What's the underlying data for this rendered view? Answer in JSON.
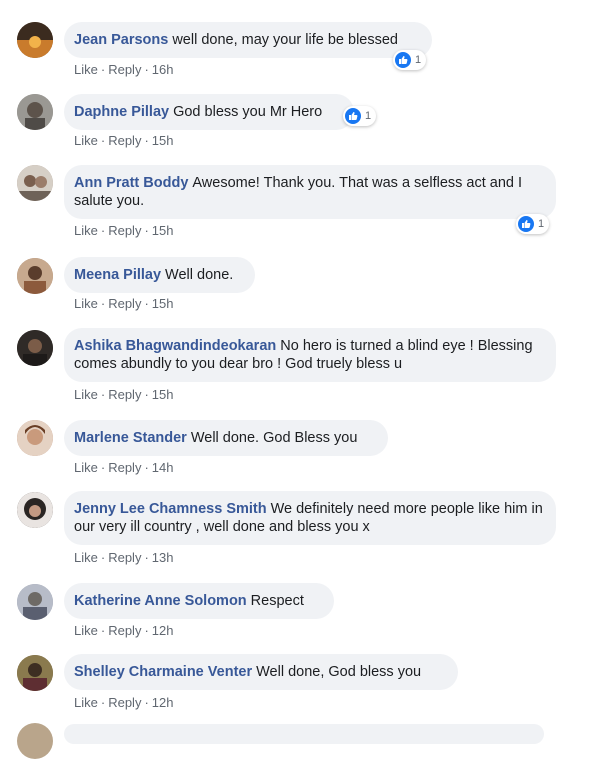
{
  "action_labels": {
    "like": "Like",
    "reply": "Reply",
    "separator": "·"
  },
  "comments": [
    {
      "author": "Jean Parsons",
      "text": "well done, may your life be blessed",
      "time": "16h",
      "reactions": "1",
      "avatar_color": "#6b4a2a"
    },
    {
      "author": "Daphne Pillay",
      "text": "God bless you Mr Hero",
      "time": "15h",
      "reactions": "1",
      "avatar_color": "#8c8a86"
    },
    {
      "author": "Ann Pratt Boddy",
      "text": "Awesome! Thank you. That was a selfless act and I salute you.",
      "time": "15h",
      "reactions": "1",
      "avatar_color": "#a49388"
    },
    {
      "author": "Meena Pillay",
      "text": "Well done.",
      "time": "15h",
      "reactions": "",
      "avatar_color": "#9d7a62"
    },
    {
      "author": "Ashika Bhagwandindeokaran",
      "text": "No hero is turned a blind eye ! Blessing comes abundly to you dear bro ! God truely bless u",
      "time": "15h",
      "reactions": "",
      "avatar_color": "#3b3430"
    },
    {
      "author": "Marlene Stander",
      "text": "Well done. God Bless you",
      "time": "14h",
      "reactions": "",
      "avatar_color": "#b98b72"
    },
    {
      "author": "Jenny Lee Chamness Smith",
      "text": "We definitely need more people like him in our very ill country , well done and bless you x",
      "time": "13h",
      "reactions": "",
      "avatar_color": "#4a4542"
    },
    {
      "author": "Katherine Anne Solomon",
      "text": "Respect",
      "time": "12h",
      "reactions": "",
      "avatar_color": "#8f95a6"
    },
    {
      "author": "Shelley Charmaine Venter",
      "text": "Well done, God bless you",
      "time": "12h",
      "reactions": "",
      "avatar_color": "#6a5a3a"
    }
  ]
}
